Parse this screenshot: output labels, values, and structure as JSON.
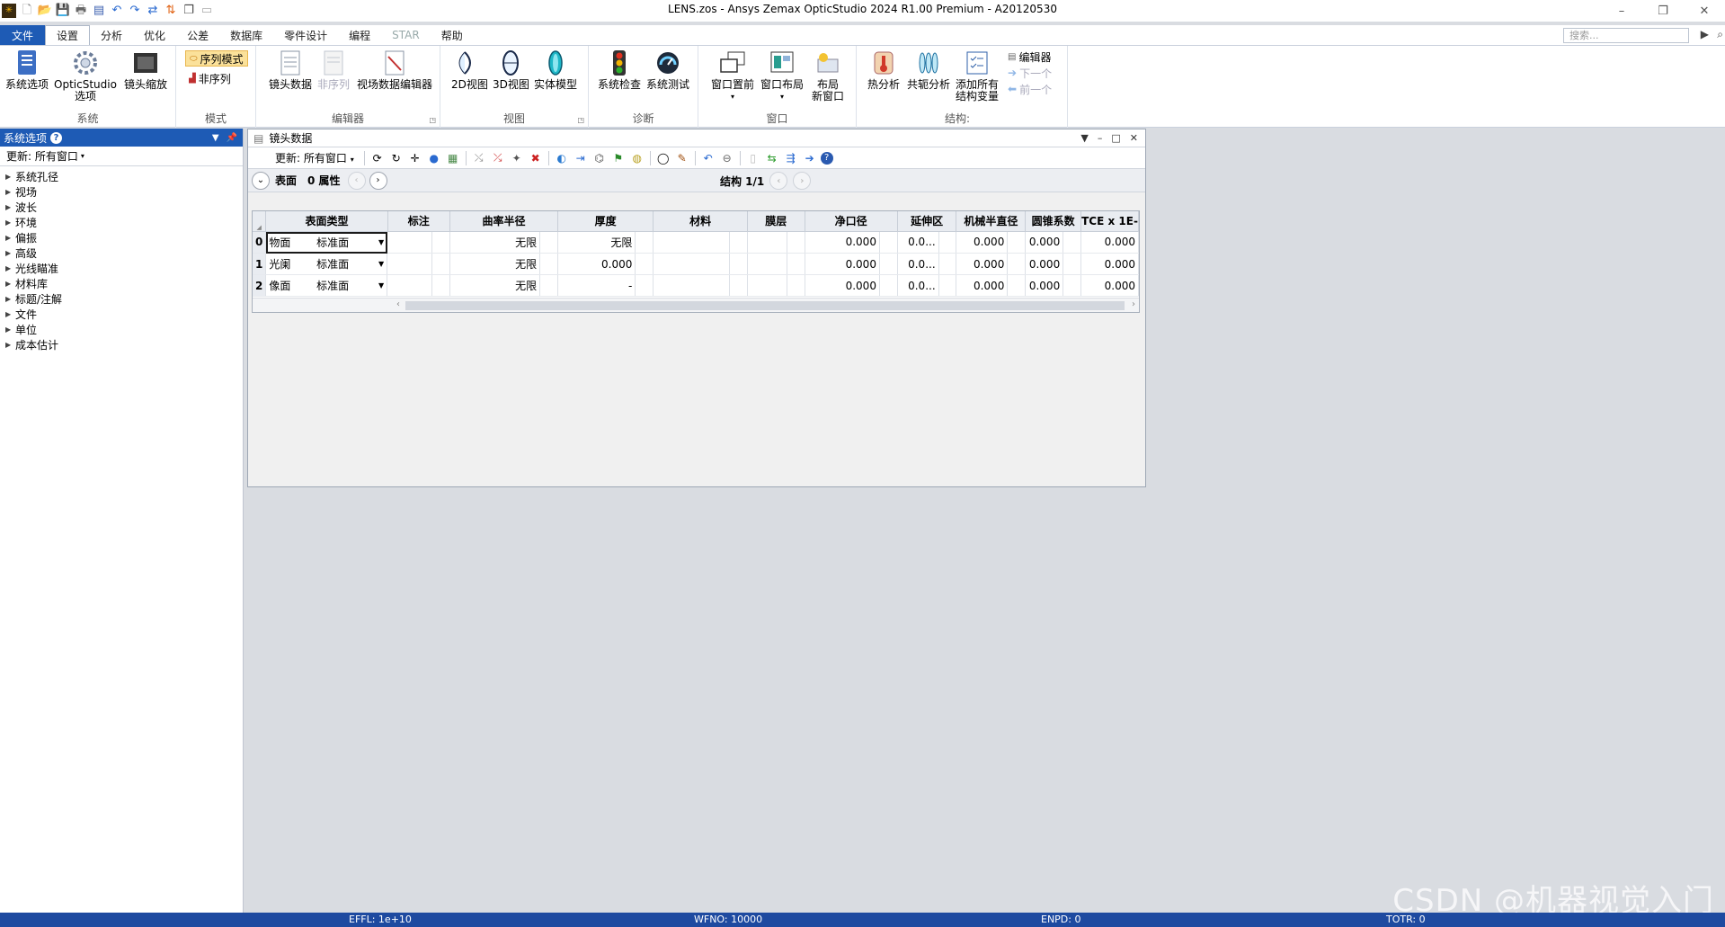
{
  "titlebar": {
    "title": "LENS.zos - Ansys Zemax OpticStudio 2024 R1.00   Premium - A20120530"
  },
  "ribbon_tabs": [
    "文件",
    "设置",
    "分析",
    "优化",
    "公差",
    "数据库",
    "零件设计",
    "编程",
    "STAR",
    "帮助"
  ],
  "search": {
    "placeholder": "搜索..."
  },
  "ribbon": {
    "system": {
      "label": "系统",
      "btn1": "系统选项",
      "btn2a": "OpticStudio",
      "btn2b": "选项",
      "btn3": "镜头缩放"
    },
    "mode": {
      "label": "模式",
      "sequential": "序列模式",
      "nonsequential": "非序列"
    },
    "editors": {
      "label": "编辑器",
      "lens_data": "镜头数据",
      "nonseq": "非序列",
      "field_editor": "视场数据编辑器"
    },
    "view": {
      "label": "视图",
      "v2d": "2D视图",
      "v3d": "3D视图",
      "solid": "实体模型"
    },
    "diag": {
      "label": "诊断",
      "check": "系统检查",
      "test": "系统测试"
    },
    "window": {
      "label": "窗口",
      "front": "窗口置前",
      "layout": "窗口布局",
      "new_a": "布局",
      "new_b": "新窗口"
    },
    "config": {
      "label": "结构:",
      "thermal": "热分析",
      "conj": "共轭分析",
      "addvar_a": "添加所有",
      "addvar_b": "结构变量",
      "editor": "编辑器",
      "next": "下一个",
      "prev": "前一个"
    }
  },
  "leftpanel": {
    "title": "系统选项",
    "update": "更新: 所有窗口",
    "items": [
      "系统孔径",
      "视场",
      "波长",
      "环境",
      "偏振",
      "高级",
      "光线瞄准",
      "材料库",
      "标题/注解",
      "文件",
      "单位",
      "成本估计"
    ]
  },
  "lenswin": {
    "title": "镜头数据",
    "update": "更新: 所有窗口",
    "nav_surface": "表面",
    "nav_props": "0 属性",
    "structure": "结构 1/1",
    "columns": [
      "表面类型",
      "标注",
      "曲率半径",
      "厚度",
      "材料",
      "膜层",
      "净口径",
      "延伸区",
      "机械半直径",
      "圆锥系数",
      "TCE x 1E-"
    ],
    "rows": [
      {
        "no": "0",
        "name": "物面",
        "type": "标准面",
        "radius": "无限",
        "thickness": "无限",
        "clear": "0.000",
        "chip": "0.0...",
        "mech": "0.000",
        "conic": "0.000",
        "tce": "0.000"
      },
      {
        "no": "1",
        "name": "光阑",
        "type": "标准面",
        "radius": "无限",
        "thickness": "0.000",
        "clear": "0.000",
        "chip": "0.0...",
        "mech": "0.000",
        "conic": "0.000",
        "tce": "0.000"
      },
      {
        "no": "2",
        "name": "像面",
        "type": "标准面",
        "radius": "无限",
        "thickness": "-",
        "clear": "0.000",
        "chip": "0.0...",
        "mech": "0.000",
        "conic": "0.000",
        "tce": "0.000"
      }
    ]
  },
  "statusbar": {
    "effl": "EFFL: 1e+10",
    "wfno": "WFNO: 10000",
    "enpd": "ENPD: 0",
    "totr": "TOTR: 0"
  },
  "watermark": "CSDN @机器视觉入门",
  "colors": {
    "accent": "#1e5bb5",
    "statusbar": "#1e4aa0",
    "highlight": "#fbe19a"
  }
}
